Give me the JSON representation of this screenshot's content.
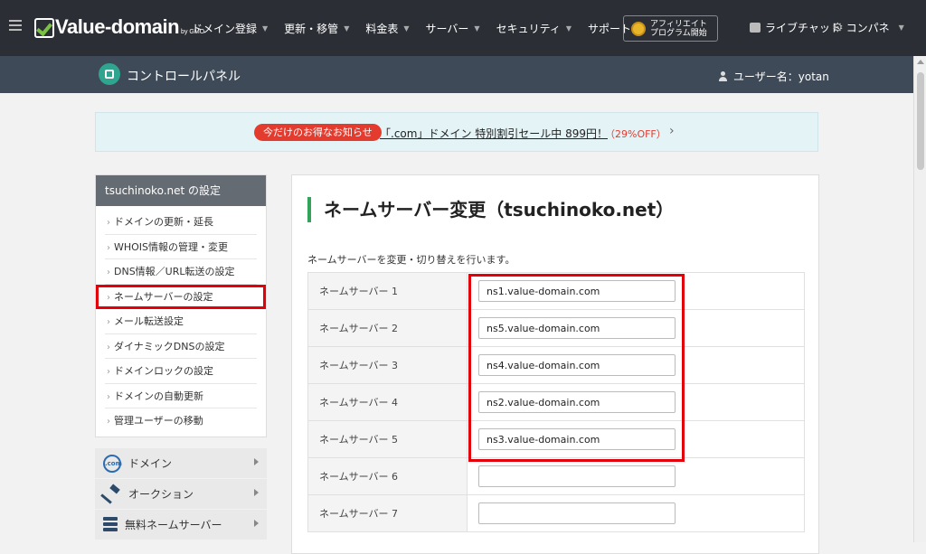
{
  "header": {
    "logo_text": "Value-domain",
    "logo_suffix": "by GMO",
    "nav": [
      {
        "label": "ドメイン登録"
      },
      {
        "label": "更新・移管"
      },
      {
        "label": "料金表"
      },
      {
        "label": "サーバー"
      },
      {
        "label": "セキュリティ"
      },
      {
        "label": "サポート"
      }
    ],
    "affiliate_line1": "アフィリエイト",
    "affiliate_line2": "プログラム開始",
    "live_chat": "ライブチャット",
    "control_panel_short": "コンパネ"
  },
  "subheader": {
    "title": "コントロールパネル",
    "user_label": "ユーザー名：yotan"
  },
  "notice": {
    "badge": "今だけのお得なお知らせ",
    "link_text": "「.com」ドメイン 特別割引セール中 899円！",
    "discount": "（29%OFF）",
    "chevron": "›"
  },
  "sidebar": {
    "heading": "tsuchinoko.net の設定",
    "items": [
      {
        "label": "ドメインの更新・延長"
      },
      {
        "label": "WHOIS情報の管理・変更"
      },
      {
        "label": "DNS情報／URL転送の設定"
      },
      {
        "label": "ネームサーバーの設定"
      },
      {
        "label": "メール転送設定"
      },
      {
        "label": "ダイナミックDNSの設定"
      },
      {
        "label": "ドメインロックの設定"
      },
      {
        "label": "ドメインの自動更新"
      },
      {
        "label": "管理ユーザーの移動"
      }
    ],
    "categories": [
      {
        "label": "ドメイン",
        "icon": "com-globe-icon"
      },
      {
        "label": "オークション",
        "icon": "auction-hammer-icon"
      },
      {
        "label": "無料ネームサーバー",
        "icon": "server-icon"
      }
    ]
  },
  "main": {
    "title": "ネームサーバー変更（tsuchinoko.net）",
    "description": "ネームサーバーを変更・切り替えを行います。",
    "nameservers": [
      {
        "label": "ネームサーバー 1",
        "value": "ns1.value-domain.com"
      },
      {
        "label": "ネームサーバー 2",
        "value": "ns5.value-domain.com"
      },
      {
        "label": "ネームサーバー 3",
        "value": "ns4.value-domain.com"
      },
      {
        "label": "ネームサーバー 4",
        "value": "ns2.value-domain.com"
      },
      {
        "label": "ネームサーバー 5",
        "value": "ns3.value-domain.com"
      },
      {
        "label": "ネームサーバー 6",
        "value": ""
      },
      {
        "label": "ネームサーバー 7",
        "value": ""
      }
    ]
  },
  "colors": {
    "nav_bg": "#2b2f35",
    "subheader_bg": "#3e4a58",
    "accent_green": "#33a35c",
    "highlight_red": "#e3000b",
    "badge_red": "#e43b2f"
  }
}
